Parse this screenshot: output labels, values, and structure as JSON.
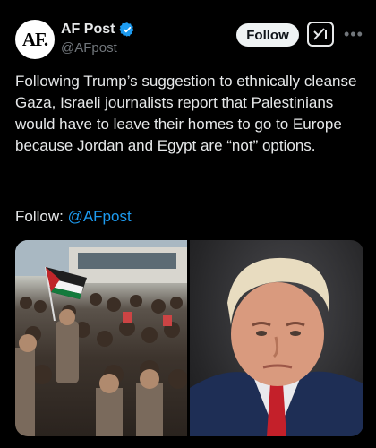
{
  "author": {
    "avatar_text": "AF.",
    "name": "AF Post",
    "handle": "@AFpost"
  },
  "actions": {
    "follow_label": "Follow",
    "grok_icon": "grok-icon",
    "more_icon": "more-icon"
  },
  "post": {
    "text": "Following Trump’s suggestion to ethnically cleanse Gaza, Israeli journalists report that Palestinians would have to leave their homes to go to Europe because Jordan and Egypt are “not” options.",
    "follow_prefix": "Follow: ",
    "follow_handle": "@AFpost"
  },
  "media": {
    "left_image": "crowd-with-palestinian-flag-photo",
    "right_image": "portrait-photo-man-in-suit"
  },
  "colors": {
    "background": "#000000",
    "text": "#e7e9ea",
    "secondary": "#71767b",
    "link": "#1d9bf0",
    "verified": "#1d9bf0"
  }
}
